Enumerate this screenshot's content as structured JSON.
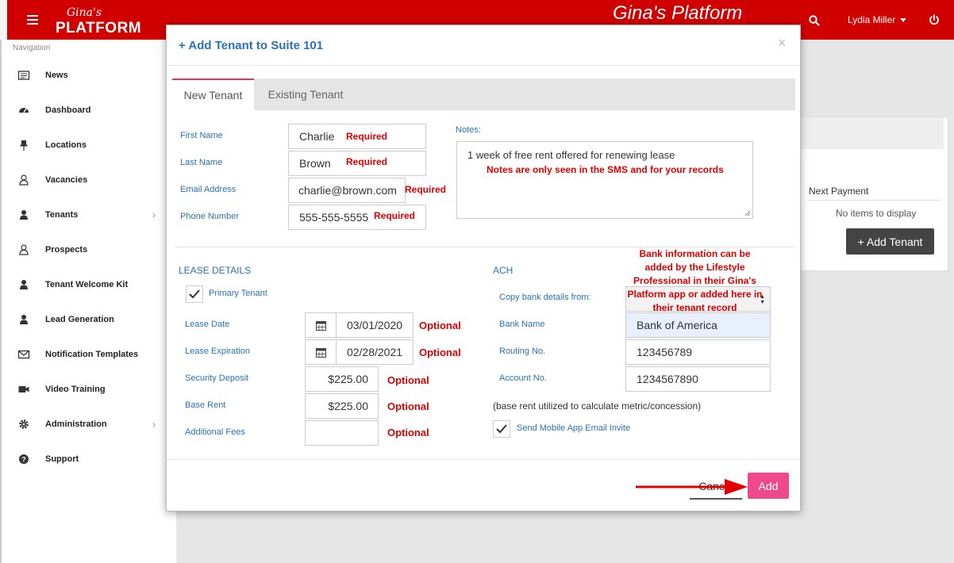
{
  "app": {
    "logo_script": "Gina's",
    "logo_word": "PLATFORM",
    "title": "Gina's Platform",
    "user_name": "Lydia Miller"
  },
  "colors": {
    "brand_red": "#d10000",
    "link_blue": "#2a72b5",
    "alert_red": "#e00000",
    "add_pink": "#ee4a8b"
  },
  "sidebar": {
    "title": "Navigation",
    "items": [
      {
        "label": "News",
        "icon": "newspaper-icon"
      },
      {
        "label": "Dashboard",
        "icon": "dashboard-gauge-icon"
      },
      {
        "label": "Locations",
        "icon": "pushpin-icon"
      },
      {
        "label": "Vacancies",
        "icon": "user-outline-icon"
      },
      {
        "label": "Tenants",
        "icon": "user-icon",
        "has_submenu": true
      },
      {
        "label": "Prospects",
        "icon": "user-outline-icon"
      },
      {
        "label": "Tenant Welcome Kit",
        "icon": "user-icon"
      },
      {
        "label": "Lead Generation",
        "icon": "user-icon"
      },
      {
        "label": "Notification Templates",
        "icon": "envelope-icon"
      },
      {
        "label": "Video Training",
        "icon": "video-camera-icon"
      },
      {
        "label": "Administration",
        "icon": "gear-icon",
        "has_submenu": true
      },
      {
        "label": "Support",
        "icon": "question-circle-icon"
      }
    ]
  },
  "background": {
    "column_header": "Next Payment",
    "empty_text": "No items to display",
    "add_tenant_button": "+ Add Tenant"
  },
  "modal": {
    "title": "+ Add Tenant to Suite 101",
    "tabs": [
      "New Tenant",
      "Existing Tenant"
    ],
    "active_tab": "New Tenant",
    "required_text": "Required",
    "optional_text": "Optional",
    "fields": {
      "first_name": {
        "label": "First Name",
        "value": "Charlie"
      },
      "last_name": {
        "label": "Last Name",
        "value": "Brown"
      },
      "email": {
        "label": "Email Address",
        "value": "charlie@brown.com"
      },
      "phone": {
        "label": "Phone Number",
        "value": "555-555-5555"
      }
    },
    "notes": {
      "label": "Notes:",
      "value": "1 week of free rent offered for renewing lease",
      "annotation": "Notes are only seen in the SMS and for your records"
    },
    "lease": {
      "title": "LEASE DETAILS",
      "primary_tenant_label": "Primary Tenant",
      "primary_tenant_checked": true,
      "lease_date": {
        "label": "Lease Date",
        "value": "03/01/2020"
      },
      "lease_expiration": {
        "label": "Lease Expiration",
        "value": "02/28/2021"
      },
      "security_deposit": {
        "label": "Security Deposit",
        "value": "$225.00"
      },
      "base_rent": {
        "label": "Base Rent",
        "value": "$225.00"
      },
      "additional_fees": {
        "label": "Additional Fees",
        "value": ""
      }
    },
    "ach": {
      "title": "ACH",
      "copy_label": "Copy bank details from:",
      "copy_value": "",
      "bank_info_annotation": "Bank information can be added by the Lifestyle Professional in their Gina's Platform app or added here in their tenant record",
      "bank_name": {
        "label": "Bank Name",
        "value": "Bank of America"
      },
      "routing": {
        "label": "Routing No.",
        "value": "123456789"
      },
      "account": {
        "label": "Account No.",
        "value": "1234567890"
      },
      "base_rent_note": "(base rent utilized to calculate metric/concession)",
      "send_invite_label": "Send Mobile App Email Invite",
      "send_invite_checked": true
    },
    "footer": {
      "cancel_label": "Cancel",
      "add_label": "Add"
    }
  }
}
